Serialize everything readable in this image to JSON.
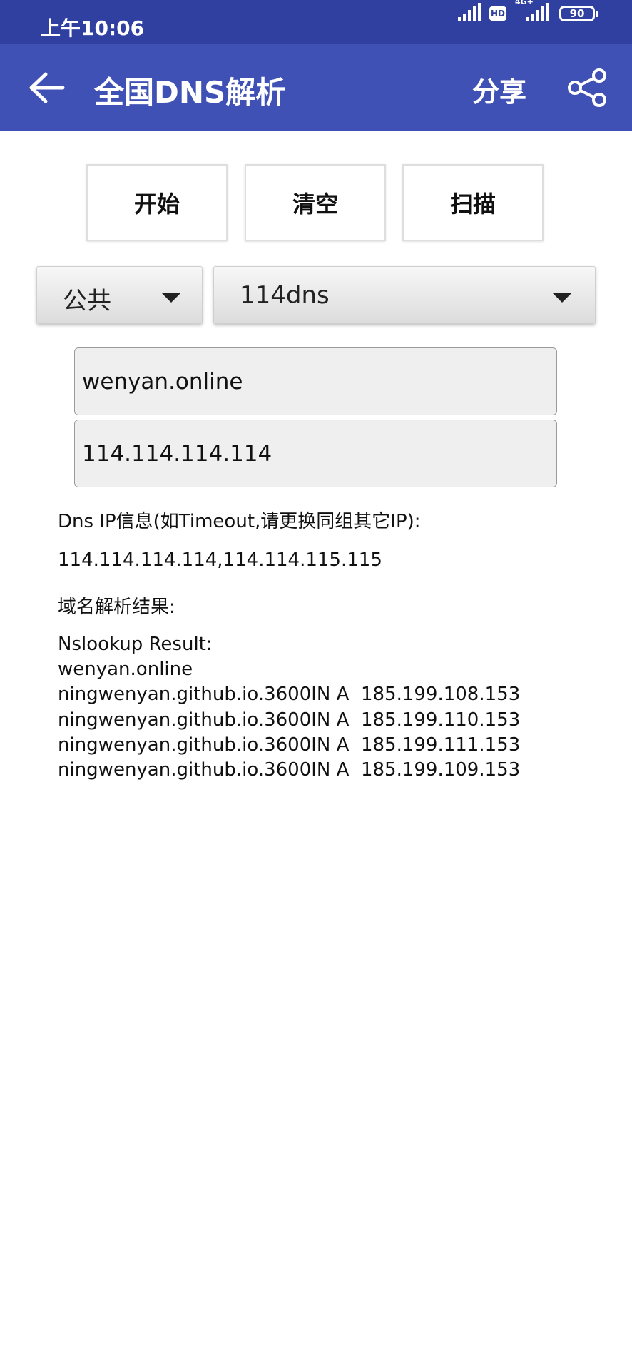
{
  "status_bar": {
    "time": "上午10:06",
    "hd_label": "HD",
    "network_label": "4G+",
    "battery": "90"
  },
  "app_bar": {
    "title": "全国DNS解析",
    "share_label": "分享"
  },
  "actions": {
    "start": "开始",
    "clear": "清空",
    "scan": "扫描"
  },
  "selectors": {
    "group": "公共",
    "provider": "114dns"
  },
  "inputs": {
    "domain": "wenyan.online",
    "dns_server": "114.114.114.114"
  },
  "info": {
    "dns_ip_label": "Dns IP信息(如Timeout,请更换同组其它IP):",
    "dns_ips": "114.114.114.114,114.114.115.115",
    "result_label": "域名解析结果:"
  },
  "result_lines": [
    "Nslookup Result:",
    "wenyan.online",
    "ningwenyan.github.io.3600IN A  185.199.108.153",
    "ningwenyan.github.io.3600IN A  185.199.110.153",
    "ningwenyan.github.io.3600IN A  185.199.111.153",
    "ningwenyan.github.io.3600IN A  185.199.109.153"
  ],
  "colors": {
    "status_bar": "#2f40a0",
    "app_bar": "#3f51b5"
  }
}
